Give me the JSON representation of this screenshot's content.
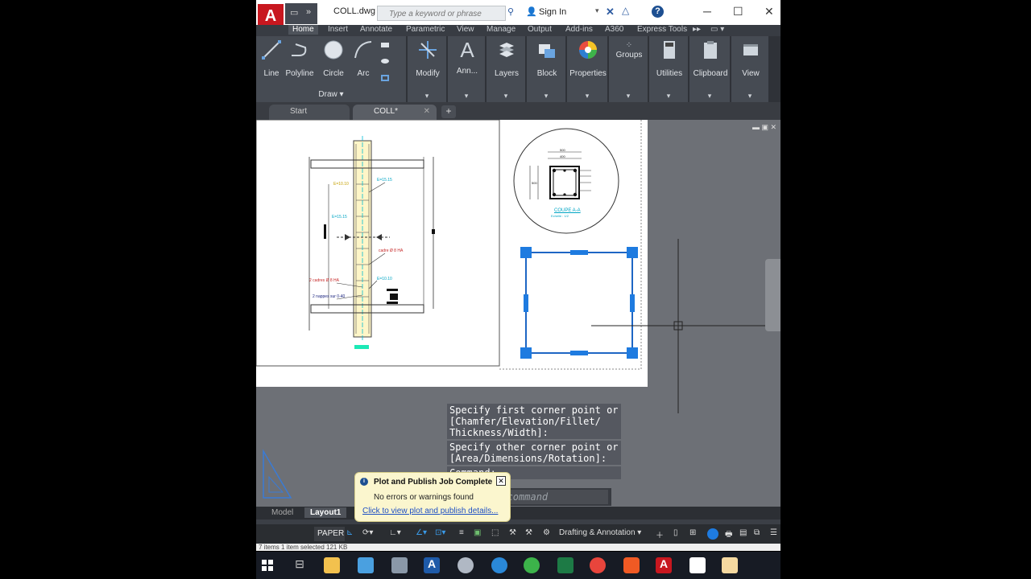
{
  "titlebar": {
    "logo_letter": "A",
    "doc_name": "COLL.dwg",
    "search_placeholder": "Type a keyword or phrase",
    "signin_label": "Sign In",
    "minimize": "─",
    "maximize": "☐",
    "close": "✕"
  },
  "ribbon_tabs": [
    "Home",
    "Insert",
    "Annotate",
    "Parametric",
    "View",
    "Manage",
    "Output",
    "Add-ins",
    "A360",
    "Express Tools"
  ],
  "ribbon": {
    "line": "Line",
    "polyline": "Polyline",
    "circle": "Circle",
    "arc": "Arc",
    "draw_panel": "Draw",
    "modify": "Modify",
    "annotation": "Ann...",
    "layers": "Layers",
    "block": "Block",
    "properties": "Properties",
    "groups": "Groups",
    "utilities": "Utilities",
    "clipboard": "Clipboard",
    "view": "View"
  },
  "doc_tabs": {
    "start": "Start",
    "coll": "COLL*",
    "add": "+"
  },
  "drawing": {
    "section_title": "COUPE A-A",
    "section_scale": "Echelle : 1/2",
    "dim_top1": "500",
    "dim_top2": "400",
    "dim_side": "500",
    "lbl_cadre": "cadre Ø 8 HA",
    "lbl_2cadres": "2 cadres Ø 8 HA",
    "lbl_2nappes": "2 nappes sur 0-40",
    "lbl_esp1": "E=10.10",
    "lbl_esp2": "E=15.15",
    "lbl_esp3": "E=15.15",
    "lbl_esp4": "E=10.10"
  },
  "command": {
    "line1": "Specify first corner point or",
    "line2": "[Chamfer/Elevation/Fillet/",
    "line3": "Thickness/Width]:",
    "line4": "Specify other corner point or",
    "line5": "[Area/Dimensions/Rotation]:",
    "line6": "Command:",
    "placeholder": "Type a command"
  },
  "notification": {
    "title": "Plot and Publish Job Complete",
    "body": "No errors or warnings found",
    "link": "Click to view plot and publish details..."
  },
  "layout_tabs": {
    "model": "Model",
    "layout1": "Layout1",
    "add": "+"
  },
  "statusbar": {
    "paper": "PAPER",
    "workspace": "Drafting & Annotation",
    "items_text": "7 items    1 item selected  121 KB"
  },
  "colors": {
    "accent_red": "#c8171f",
    "ribbon_bg": "#464b53",
    "canvas_bg": "#6d7076",
    "grip_blue": "#1e7be0"
  }
}
